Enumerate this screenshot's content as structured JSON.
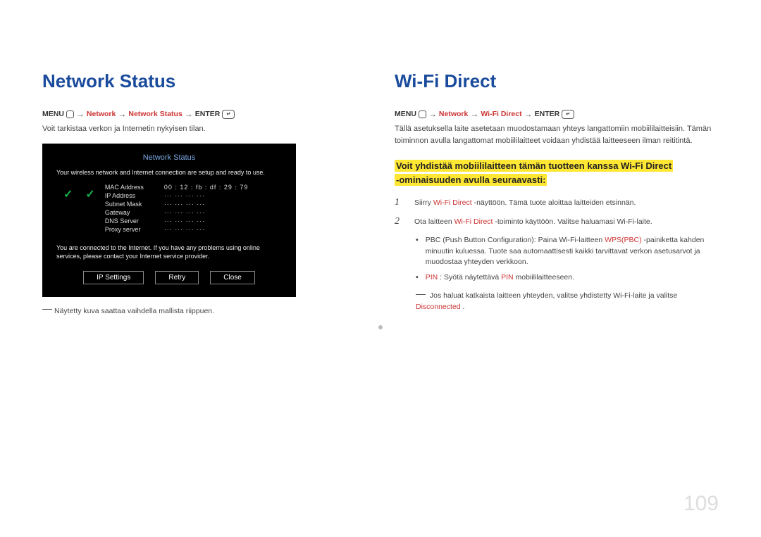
{
  "page_number": "109",
  "left": {
    "title": "Network Status",
    "breadcrumb": {
      "prefix": "MENU",
      "items": [
        "Network",
        "Network Status"
      ],
      "suffix": "ENTER"
    },
    "desc": "Voit tarkistaa verkon ja Internetin nykyisen tilan.",
    "panel": {
      "title": "Network Status",
      "line1": "Your wireless network and Internet connection are setup and ready to use.",
      "kv": [
        {
          "k": "MAC Address",
          "v": "00 : 12 : fb : df : 29 : 79"
        },
        {
          "k": "IP Address",
          "v": "···  ···  ···  ···"
        },
        {
          "k": "Subnet Mask",
          "v": "···  ···  ···  ···"
        },
        {
          "k": "Gateway",
          "v": "···  ···  ···  ···"
        },
        {
          "k": "DNS Server",
          "v": "···  ···  ···  ···"
        },
        {
          "k": "Proxy server",
          "v": "···  ···  ···  ···"
        }
      ],
      "msg": "You are connected to the Internet. If you have any problems using online services, please contact your Internet service provider.",
      "buttons": [
        "IP Settings",
        "Retry",
        "Close"
      ]
    },
    "note": "Näytetty kuva saattaa vaihdella mallista riippuen."
  },
  "right": {
    "title": "Wi-Fi Direct",
    "breadcrumb": {
      "prefix": "MENU",
      "items": [
        "Network",
        "Wi-Fi Direct"
      ],
      "suffix": "ENTER"
    },
    "desc": "Tällä asetuksella laite asetetaan muodostamaan yhteys langattomiin mobiililaitteisiin. Tämän toiminnon avulla langattomat mobiililaitteet voidaan yhdistää laitteeseen ilman reititintä.",
    "highlight_l1": "Voit yhdistää mobiililaitteen tämän tuotteen kanssa Wi-Fi Direct",
    "highlight_l2": "-ominaisuuden avulla seuraavasti:",
    "steps": [
      {
        "n": "1",
        "pre": "Siirry",
        "red": "Wi-Fi Direct",
        "post": " -näyttöön. Tämä tuote aloittaa laitteiden etsinnän."
      },
      {
        "n": "2",
        "pre": "Ota laitteen",
        "red": "Wi-Fi Direct",
        "post": " -toiminto käyttöön. Valitse haluamasi Wi-Fi-laite."
      }
    ],
    "bullet1": {
      "pre": "PBC (Push Button Configuration): Paina Wi-Fi-laitteen",
      "red": "WPS(PBC)",
      "post": " -painiketta kahden minuutin kuluessa. Tuote saa automaattisesti kaikki tarvittavat verkon asetusarvot ja muodostaa yhteyden verkkoon."
    },
    "bullet2": {
      "red1": "PIN",
      "mid": ": Syötä näytettävä",
      "red2": "PIN",
      "post": " mobiililaitteeseen."
    },
    "footnote": {
      "pre": "Jos haluat katkaista laitteen yhteyden, valitse yhdistetty Wi-Fi-laite ja valitse",
      "red": "Disconnected",
      "post": "."
    }
  }
}
